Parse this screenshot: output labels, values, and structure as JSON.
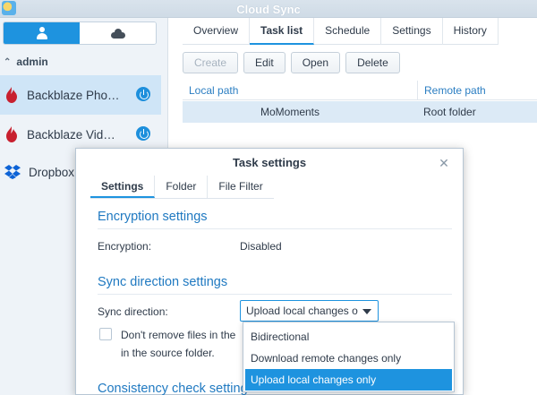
{
  "window": {
    "title": "Cloud Sync"
  },
  "sidebar": {
    "group": "admin",
    "items": [
      {
        "label": "Backblaze Pho…",
        "icon": "backblaze-flame-icon",
        "selected": true,
        "power": true
      },
      {
        "label": "Backblaze Vid…",
        "icon": "backblaze-flame-icon",
        "selected": false,
        "power": true
      },
      {
        "label": "Dropbox",
        "icon": "dropbox-icon",
        "selected": false,
        "power": false
      }
    ]
  },
  "main": {
    "tabs": [
      "Overview",
      "Task list",
      "Schedule",
      "Settings",
      "History"
    ],
    "active_tab": "Task list",
    "toolbar": {
      "create": "Create",
      "edit": "Edit",
      "open": "Open",
      "delete": "Delete"
    },
    "table": {
      "headers": [
        "Local path",
        "Remote path"
      ],
      "rows": [
        {
          "local_path": "MoMoments",
          "remote_path": "Root folder"
        }
      ]
    }
  },
  "dialog": {
    "title": "Task settings",
    "tabs": [
      "Settings",
      "Folder",
      "File Filter"
    ],
    "encryption": {
      "section": "Encryption settings",
      "label": "Encryption:",
      "value": "Disabled"
    },
    "sync_direction": {
      "section": "Sync direction settings",
      "label": "Sync direction:",
      "selected": "Upload local changes o",
      "checkbox_line1": "Don't remove files in the d",
      "checkbox_line2": "in the source folder.",
      "options": [
        "Bidirectional",
        "Download remote changes only",
        "Upload local changes only"
      ]
    },
    "consistency": {
      "section": "Consistency check setting"
    }
  },
  "colors": {
    "accent": "#1e93df",
    "section_title": "#1f79c1",
    "selection": "#dceaf6",
    "backblaze": "#c8202f",
    "dropbox": "#0d63d6"
  }
}
